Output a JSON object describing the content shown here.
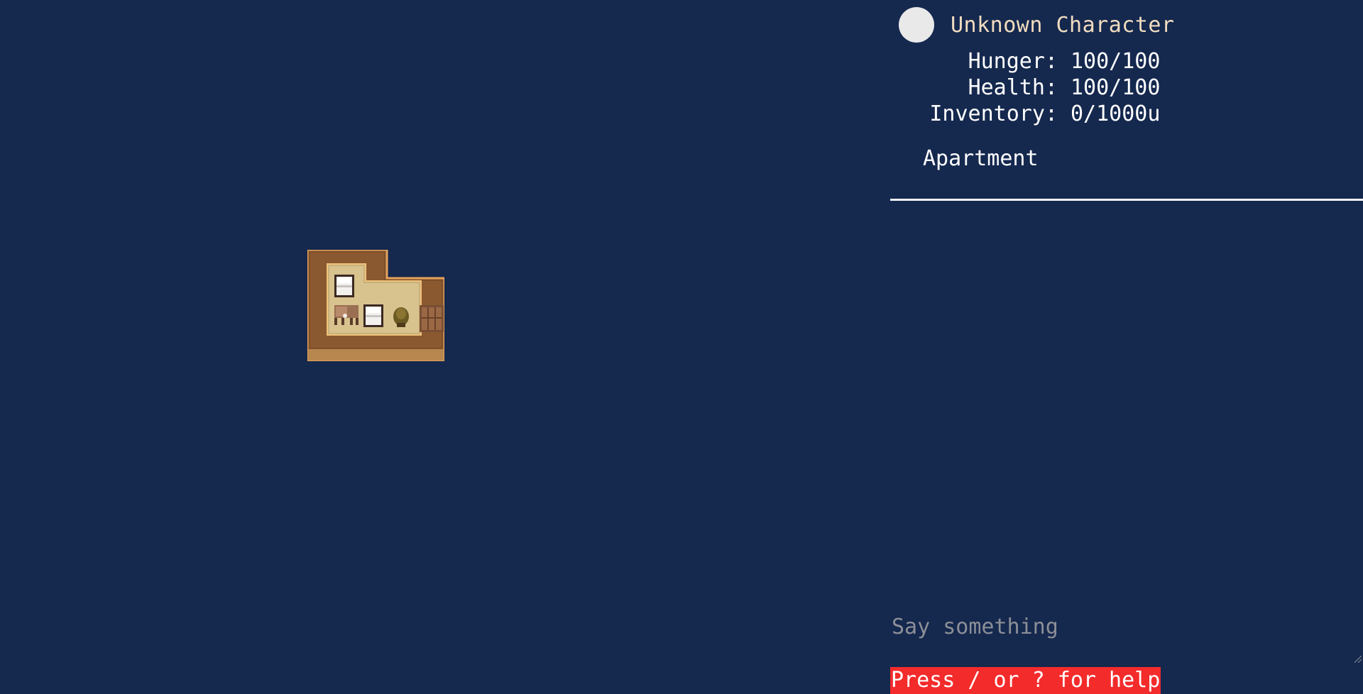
{
  "character": {
    "name": "Unknown Character",
    "avatar_color": "#e9e9ea"
  },
  "stats": [
    {
      "label": "Hunger",
      "value": "100/100",
      "current": 100,
      "max": 100
    },
    {
      "label": "Health",
      "value": "100/100",
      "current": 100,
      "max": 100
    },
    {
      "label": "Inventory",
      "value": "0/1000u",
      "current": 0,
      "max": 1000
    }
  ],
  "location": "Apartment",
  "chat": {
    "placeholder": "Say something",
    "value": ""
  },
  "help_hint": "Press / or ? for help",
  "colors": {
    "background": "#15284e",
    "name_color": "#f1dcc0",
    "help_bg": "#f42b2b",
    "divider": "#eef0f4"
  },
  "map_objects": [
    {
      "type": "room",
      "name": "apartment-room"
    },
    {
      "type": "bed",
      "name": "bed-icon"
    },
    {
      "type": "player",
      "name": "player-sprite"
    },
    {
      "type": "bed",
      "name": "second-bed-icon"
    },
    {
      "type": "plant",
      "name": "potted-plant-icon"
    },
    {
      "type": "door",
      "name": "door-icon"
    }
  ]
}
